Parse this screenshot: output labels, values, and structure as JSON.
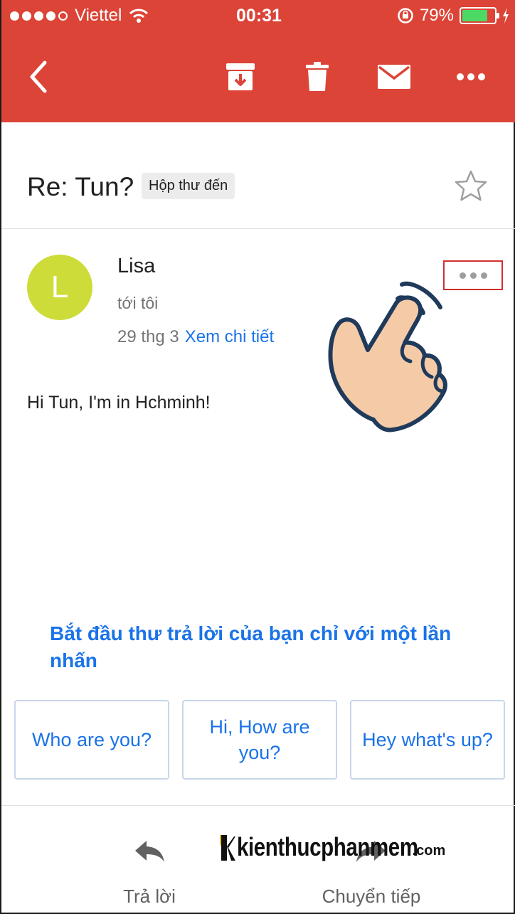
{
  "status_bar": {
    "carrier": "Viettel",
    "time": "00:31",
    "battery_percent": "79%",
    "battery_level": 0.79
  },
  "toolbar": {
    "back_icon": "back-arrow-icon",
    "archive_icon": "archive-icon",
    "delete_icon": "trash-icon",
    "mark_unread_icon": "envelope-icon",
    "more_icon": "more-horizontal-icon"
  },
  "email": {
    "subject": "Re: Tun?",
    "label": "Hộp thư đến",
    "sender_initial": "L",
    "sender_name": "Lisa",
    "recipient": "tới tôi",
    "date": "29 thg 3",
    "details_link": "Xem chi tiết",
    "body": "Hi Tun, I'm in Hchminh!"
  },
  "smart_reply": {
    "prompt": "Bắt đầu thư trả lời của bạn chỉ với một lần nhấn",
    "options": [
      "Who are you?",
      "Hi, How are you?",
      "Hey what's up?"
    ]
  },
  "actions": {
    "reply_label": "Trả lời",
    "forward_label": "Chuyển tiếp"
  },
  "watermark": {
    "text": "kienthucphanmem",
    "suffix": ".com"
  },
  "colors": {
    "header": "#db4437",
    "avatar": "#cddc39",
    "link": "#1a73e8",
    "highlight": "#d32f2f"
  }
}
